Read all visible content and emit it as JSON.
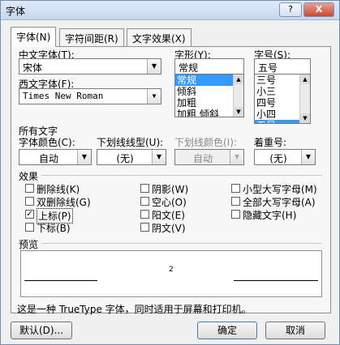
{
  "window": {
    "title": "字体",
    "help_btn": "?",
    "close_btn": "X"
  },
  "tabs": [
    {
      "label": "字体(N)"
    },
    {
      "label": "字符间距(R)"
    },
    {
      "label": "文字效果(X)"
    }
  ],
  "font": {
    "cn_font_label": "中文字体(T):",
    "cn_font_value": "宋体",
    "west_font_label": "西文字体(F):",
    "west_font_value": "Times New Roman",
    "style_label": "字形(Y):",
    "style_value": "常规",
    "style_list": [
      "常规",
      "倾斜",
      "加粗",
      "加粗 倾斜"
    ],
    "size_label": "字号(S):",
    "size_value": "五号",
    "size_list": [
      "三号",
      "小三",
      "四号",
      "小四",
      "五号"
    ]
  },
  "all_text": {
    "section_label": "所有文字",
    "color_label": "字体颜色(C):",
    "color_value": "自动",
    "underline_type_label": "下划线线型(U):",
    "underline_type_value": "(无)",
    "underline_color_label": "下划线颜色(I):",
    "underline_color_value": "自动",
    "emphasis_label": "着重号:",
    "emphasis_value": "(无)"
  },
  "effects": {
    "section_label": "效果",
    "items": [
      {
        "label": "删除线(K)",
        "checked": false
      },
      {
        "label": "双删除线(G)",
        "checked": false
      },
      {
        "label": "上标(P)",
        "checked": true
      },
      {
        "label": "下标(B)",
        "checked": false
      },
      {
        "label": "阴影(W)",
        "checked": false
      },
      {
        "label": "空心(O)",
        "checked": false
      },
      {
        "label": "阳文(E)",
        "checked": false
      },
      {
        "label": "阴文(V)",
        "checked": false
      },
      {
        "label": "小型大写字母(M)",
        "checked": false
      },
      {
        "label": "全部大写字母(A)",
        "checked": false
      },
      {
        "label": "隐藏文字(H)",
        "checked": false
      }
    ]
  },
  "preview": {
    "label": "预览",
    "superscript": "2"
  },
  "description": "这是一种 TrueType 字体，同时适用于屏幕和打印机。",
  "buttons": {
    "default": "默认(D)...",
    "ok": "确定",
    "cancel": "取消"
  }
}
